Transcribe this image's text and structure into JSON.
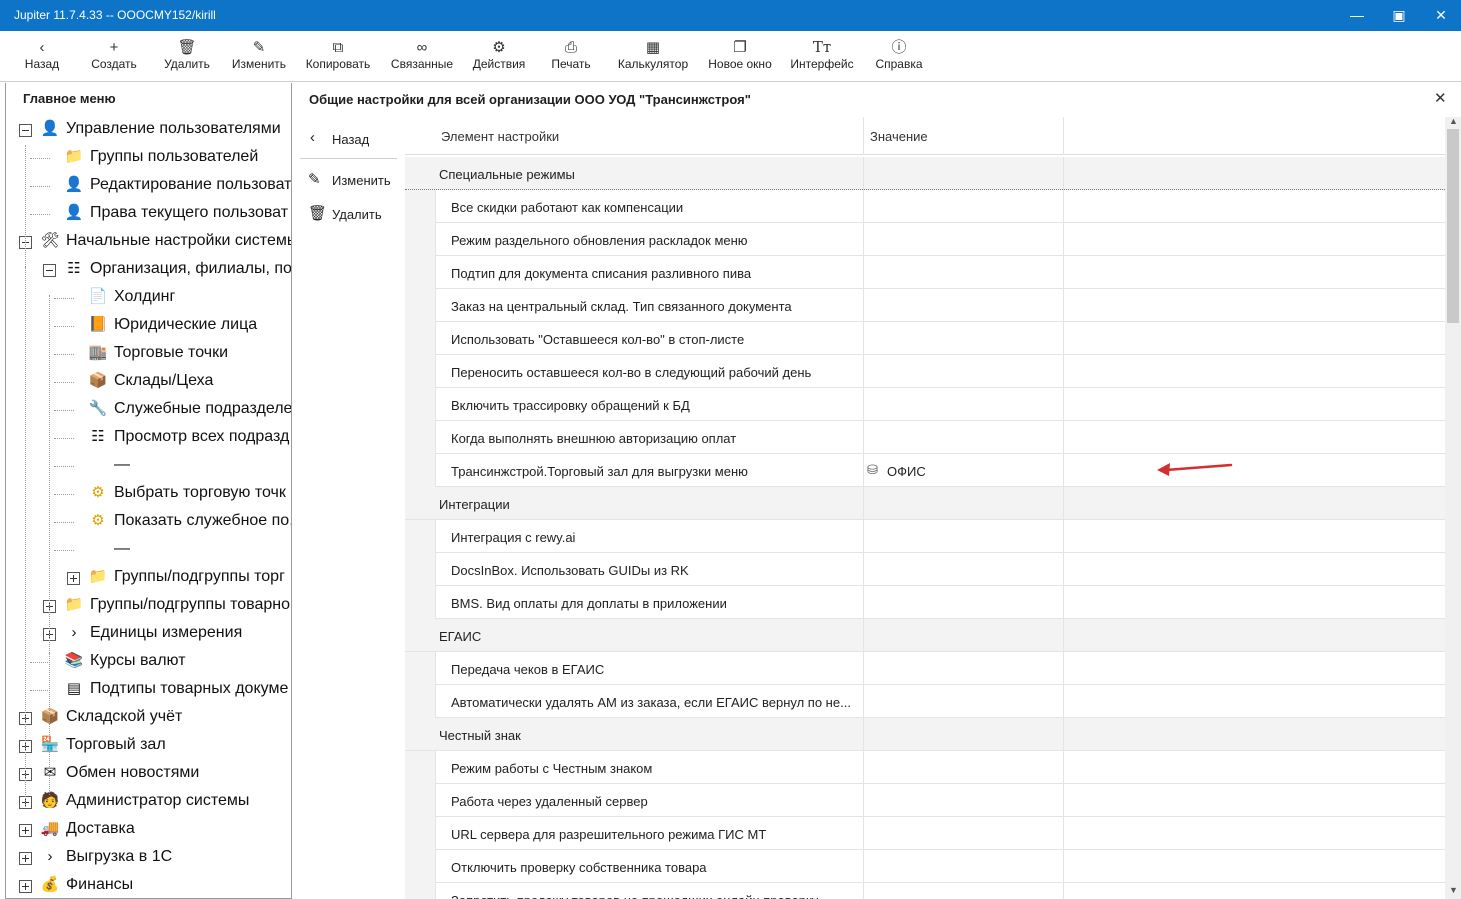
{
  "window": {
    "title": "Jupiter 11.7.4.33 -- OOOCMY152/kirill"
  },
  "toolbar": [
    {
      "label": "Назад",
      "icon": "back-icon"
    },
    {
      "label": "Создать",
      "icon": "plus-icon"
    },
    {
      "label": "Удалить",
      "icon": "trash-icon"
    },
    {
      "label": "Изменить",
      "icon": "edit-icon"
    },
    {
      "label": "Копировать",
      "icon": "copy-icon"
    },
    {
      "label": "Связанные",
      "icon": "link-icon"
    },
    {
      "label": "Действия",
      "icon": "gear-icon"
    },
    {
      "label": "Печать",
      "icon": "print-icon"
    },
    {
      "label": "Калькулятор",
      "icon": "calculator-icon"
    },
    {
      "label": "Новое окно",
      "icon": "new-window-icon"
    },
    {
      "label": "Интерфейс",
      "icon": "font-icon"
    },
    {
      "label": "Справка",
      "icon": "info-icon"
    }
  ],
  "sidebar": {
    "title": "Главное меню",
    "items": [
      {
        "label": "Управление пользователями",
        "icon": "user-icon"
      },
      {
        "label": "Группы пользователей",
        "icon": "folder-icon"
      },
      {
        "label": "Редактирование пользоват",
        "icon": "user-edit-icon"
      },
      {
        "label": "Права текущего пользоват",
        "icon": "user-rights-icon"
      },
      {
        "label": "Начальные настройки системы",
        "icon": "tools-icon"
      },
      {
        "label": "Организация, филиалы, по,",
        "icon": "org-icon"
      },
      {
        "label": "Холдинг",
        "icon": "document-icon"
      },
      {
        "label": "Юридические лица",
        "icon": "book-icon"
      },
      {
        "label": "Торговые точки",
        "icon": "shop-icon"
      },
      {
        "label": "Склады/Цеха",
        "icon": "boxes-icon"
      },
      {
        "label": "Служебные подразделе",
        "icon": "wrench-icon"
      },
      {
        "label": "Просмотр всех подразд",
        "icon": "org-icon"
      },
      {
        "label": "—",
        "icon": ""
      },
      {
        "label": "Выбрать торговую точк",
        "icon": "gear-icon"
      },
      {
        "label": "Показать служебное по,",
        "icon": "gear-icon"
      },
      {
        "label": "—",
        "icon": ""
      },
      {
        "label": "Группы/подгруппы торг",
        "icon": "folder-icon"
      },
      {
        "label": "Группы/подгруппы товарно",
        "icon": "folder-icon"
      },
      {
        "label": "Единицы измерения",
        "icon": "chevron-right-icon"
      },
      {
        "label": "Курсы валют",
        "icon": "books-icon"
      },
      {
        "label": "Подтипы товарных докуме",
        "icon": "table-icon"
      },
      {
        "label": "Складской учёт",
        "icon": "boxes-icon"
      },
      {
        "label": "Торговый зал",
        "icon": "store-icon"
      },
      {
        "label": "Обмен новостями",
        "icon": "mail-icon"
      },
      {
        "label": "Администратор системы",
        "icon": "admin-icon"
      },
      {
        "label": "Доставка",
        "icon": "truck-icon"
      },
      {
        "label": "Выгрузка в 1С",
        "icon": "chevron-right-icon"
      },
      {
        "label": "Финансы",
        "icon": "money-icon"
      }
    ]
  },
  "panel": {
    "title": "Общие настройки для всей организации ООО УОД \"Трансинжстроя\"",
    "back_label": "Назад",
    "edit_label": "Изменить",
    "delete_label": "Удалить",
    "col_name": "Элемент настройки",
    "col_value": "Значение",
    "rows": [
      {
        "name": "Специальные режимы",
        "group": true,
        "value": ""
      },
      {
        "name": "Все скидки работают как компенсации",
        "value": ""
      },
      {
        "name": "Режим раздельного обновления раскладок меню",
        "value": ""
      },
      {
        "name": "Подтип для документа списания разливного пива",
        "value": ""
      },
      {
        "name": "Заказ на центральный склад. Тип связанного документа",
        "value": ""
      },
      {
        "name": "Использовать \"Оставшееся кол-во\" в стоп-листе",
        "value": ""
      },
      {
        "name": "Переносить оставшееся кол-во в следующий рабочий день",
        "value": ""
      },
      {
        "name": "Включить трассировку обращений к БД",
        "value": ""
      },
      {
        "name": "Когда выполнять внешнюю авторизацию оплат",
        "value": ""
      },
      {
        "name": "Трансинжстрой.Торговый зал для выгрузки меню",
        "value": "ОФИС"
      },
      {
        "name": "Интеграции",
        "group": true,
        "value": ""
      },
      {
        "name": "Интеграция с rewy.ai",
        "value": ""
      },
      {
        "name": "DocsInBox. Использовать GUIDы из RK",
        "value": ""
      },
      {
        "name": "BMS. Вид оплаты для доплаты в приложении",
        "value": ""
      },
      {
        "name": "ЕГАИС",
        "group": true,
        "value": ""
      },
      {
        "name": "Передача чеков в ЕГАИС",
        "value": ""
      },
      {
        "name": "Автоматически удалять АМ из заказа, если ЕГАИС вернул по не...",
        "value": ""
      },
      {
        "name": "Честный знак",
        "group": true,
        "value": ""
      },
      {
        "name": "Режим работы с Честным знаком",
        "value": ""
      },
      {
        "name": "Работа через удаленный сервер",
        "value": ""
      },
      {
        "name": "URL сервера для разрешительного режима ГИС МТ",
        "value": ""
      },
      {
        "name": "Отключить проверку собственника товара",
        "value": ""
      },
      {
        "name": "Запретить продажу товаров не прошедших онлайн проверку",
        "value": ""
      }
    ]
  },
  "colors": {
    "titlebar": "#0e74c8",
    "arrow": "#d32f2f"
  }
}
